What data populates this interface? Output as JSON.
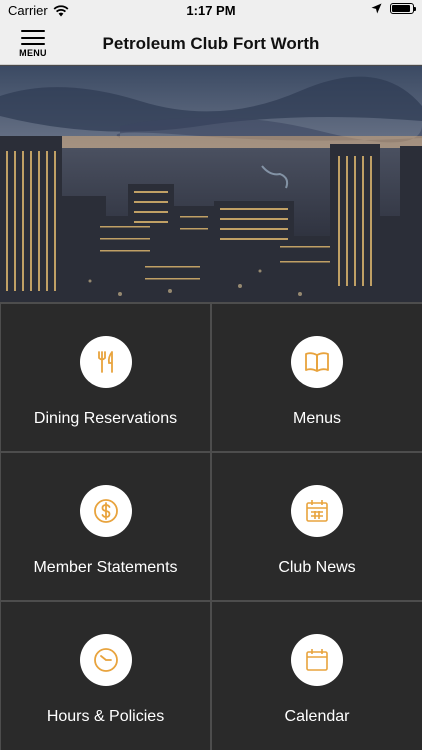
{
  "status_bar": {
    "carrier": "Carrier",
    "time": "1:17 PM",
    "battery_level": 0.9
  },
  "nav": {
    "menu_label": "MENU",
    "title": "Petroleum Club Fort Worth"
  },
  "accent_color": "#e8a33d",
  "tiles": [
    {
      "label": "Dining Reservations",
      "icon": "utensils-icon"
    },
    {
      "label": "Menus",
      "icon": "book-open-icon"
    },
    {
      "label": "Member Statements",
      "icon": "dollar-icon"
    },
    {
      "label": "Club News",
      "icon": "calendar-grid-icon"
    },
    {
      "label": "Hours & Policies",
      "icon": "clock-icon"
    },
    {
      "label": "Calendar",
      "icon": "calendar-icon"
    }
  ]
}
